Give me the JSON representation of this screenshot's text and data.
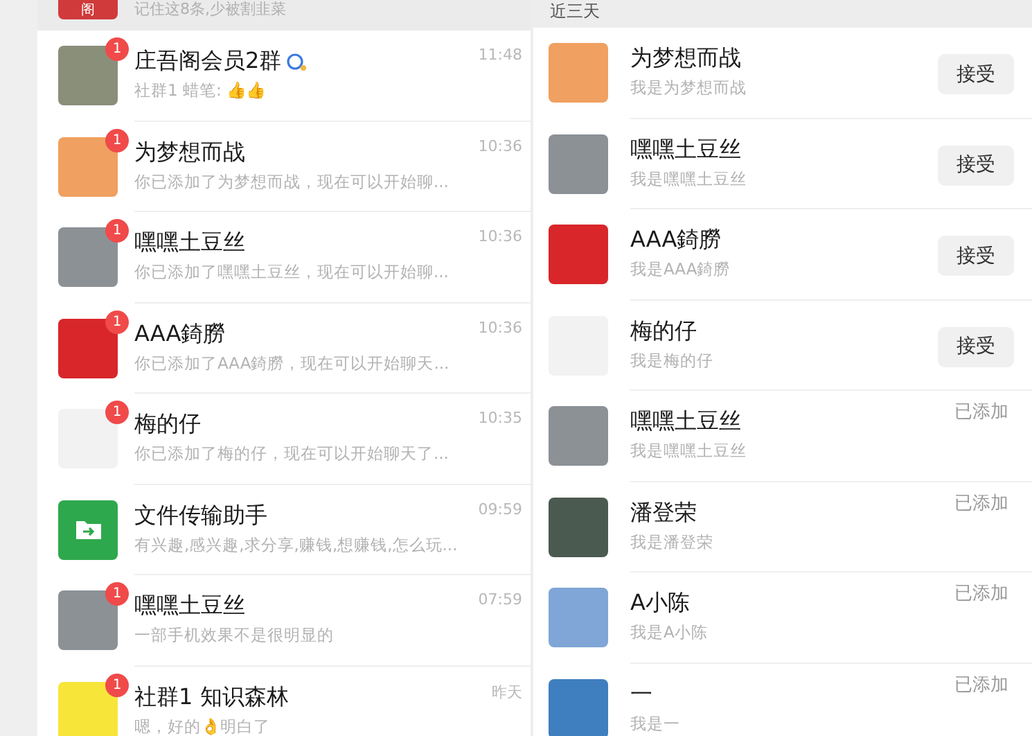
{
  "pinned": {
    "avatar_text": "阁",
    "preview": "记住这8条,少被割韭菜"
  },
  "chats": [
    {
      "name": "庄吾阁会员2群",
      "community": true,
      "kind": "group",
      "badge": "1",
      "time": "11:48",
      "preview": "社群1 蜡笔: 👍👍"
    },
    {
      "name": "为梦想而战",
      "community": false,
      "kind": "orange",
      "badge": "1",
      "time": "10:36",
      "preview": "你已添加了为梦想而战，现在可以开始聊..."
    },
    {
      "name": "嘿嘿土豆丝",
      "community": false,
      "kind": "beach",
      "badge": "1",
      "time": "10:36",
      "preview": "你已添加了嘿嘿土豆丝，现在可以开始聊..."
    },
    {
      "name": "AAA錡朥",
      "community": false,
      "kind": "red",
      "badge": "1",
      "time": "10:36",
      "preview": "你已添加了AAA錡朥，现在可以开始聊天..."
    },
    {
      "name": "梅的仔",
      "community": false,
      "kind": "light",
      "badge": "1",
      "time": "10:35",
      "preview": "你已添加了梅的仔，现在可以开始聊天了..."
    },
    {
      "name": "文件传输助手",
      "community": false,
      "kind": "file",
      "time": "09:59",
      "preview": "有兴趣,感兴趣,求分享,赚钱,想赚钱,怎么玩..."
    },
    {
      "name": "嘿嘿土豆丝",
      "community": false,
      "kind": "beach",
      "badge": "1",
      "time": "07:59",
      "preview": "一部手机效果不是很明显的"
    },
    {
      "name": "社群1 知识森林",
      "community": false,
      "kind": "yellow",
      "badge": "1",
      "time": "昨天",
      "preview": "嗯，好的👌明白了"
    }
  ],
  "requests_header": "近三天",
  "requests": [
    {
      "name": "为梦想而战",
      "message": "我是为梦想而战",
      "kind": "orange",
      "action": {
        "kind": "button",
        "label": "接受"
      }
    },
    {
      "name": "嘿嘿土豆丝",
      "message": "我是嘿嘿土豆丝",
      "kind": "beach",
      "action": {
        "kind": "button",
        "label": "接受"
      }
    },
    {
      "name": "AAA錡朥",
      "message": "我是AAA錡朥",
      "kind": "red",
      "action": {
        "kind": "button",
        "label": "接受"
      }
    },
    {
      "name": "梅的仔",
      "message": "我是梅的仔",
      "kind": "light",
      "action": {
        "kind": "button",
        "label": "接受"
      }
    },
    {
      "name": "嘿嘿土豆丝",
      "message": "我是嘿嘿土豆丝",
      "kind": "beach",
      "action": {
        "kind": "status",
        "label": "已添加"
      }
    },
    {
      "name": "潘登荣",
      "message": "我是潘登荣",
      "kind": "lake",
      "action": {
        "kind": "status",
        "label": "已添加"
      }
    },
    {
      "name": "A小陈",
      "message": "我是A小陈",
      "kind": "sky",
      "action": {
        "kind": "status",
        "label": "已添加"
      }
    },
    {
      "name": "一",
      "message": "我是一",
      "kind": "sea",
      "action": {
        "kind": "status",
        "label": "已添加"
      }
    }
  ]
}
